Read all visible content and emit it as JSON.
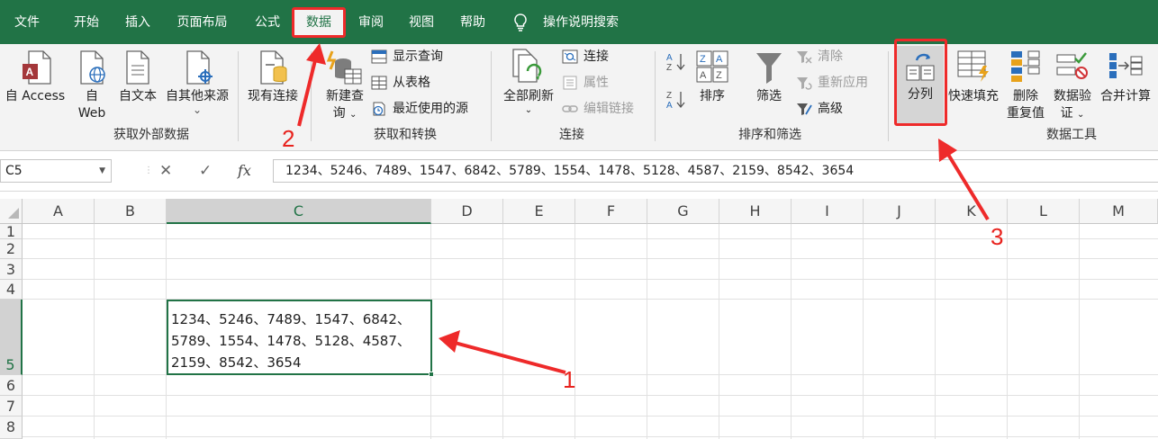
{
  "menu": {
    "tabs": [
      "文件",
      "开始",
      "插入",
      "页面布局",
      "公式",
      "数据",
      "审阅",
      "视图",
      "帮助"
    ],
    "active_tab": "数据",
    "tell_me": "操作说明搜索"
  },
  "ribbon": {
    "get_external": {
      "access": "自 Access",
      "web_line1": "自",
      "web_line2": "Web",
      "text": "自文本",
      "other_sources": "自其他来源",
      "other_sources_arrow": "⌄",
      "existing": "现有连接",
      "group_label": "获取外部数据"
    },
    "get_transform": {
      "new_query_line1": "新建查",
      "new_query_line2": "询",
      "show_queries": "显示查询",
      "from_table": "从表格",
      "recent_sources": "最近使用的源",
      "group_label": "获取和转换"
    },
    "connections": {
      "refresh_all": "全部刷新",
      "connections": "连接",
      "properties": "属性",
      "edit_links": "编辑链接",
      "group_label": "连接"
    },
    "sort_filter": {
      "sort": "排序",
      "filter": "筛选",
      "clear": "清除",
      "reapply": "重新应用",
      "advanced": "高级",
      "group_label": "排序和筛选"
    },
    "data_tools": {
      "text_to_columns": "分列",
      "flash_fill": "快速填充",
      "remove_dup_line1": "删除",
      "remove_dup_line2": "重复值",
      "validation_line1": "数据验",
      "validation_line2": "证",
      "consolidate": "合并计算",
      "group_label": "数据工具"
    }
  },
  "formula_bar": {
    "name_box": "C5",
    "cancel": "✕",
    "enter": "✓",
    "fx": "fx",
    "content": "1234、5246、7489、1547、6842、5789、1554、1478、5128、4587、2159、8542、3654"
  },
  "grid": {
    "columns": [
      "A",
      "B",
      "C",
      "D",
      "E",
      "F",
      "G",
      "H",
      "I",
      "J",
      "K",
      "L",
      "M"
    ],
    "rows": [
      "1",
      "2",
      "3",
      "4",
      "5",
      "6",
      "7",
      "8"
    ],
    "selected_column": "C",
    "selected_row": "5",
    "cell_c5_lines": [
      "1234、5246、7489、1547、6842、",
      "5789、1554、1478、5128、4587、",
      "2159、8542、3654"
    ]
  },
  "annotations": {
    "step1": "1",
    "step2": "2",
    "step3": "3",
    "color": "#ee2a2a"
  },
  "colors": {
    "excel_green": "#217346",
    "ribbon_bg": "#f3f3f3"
  }
}
